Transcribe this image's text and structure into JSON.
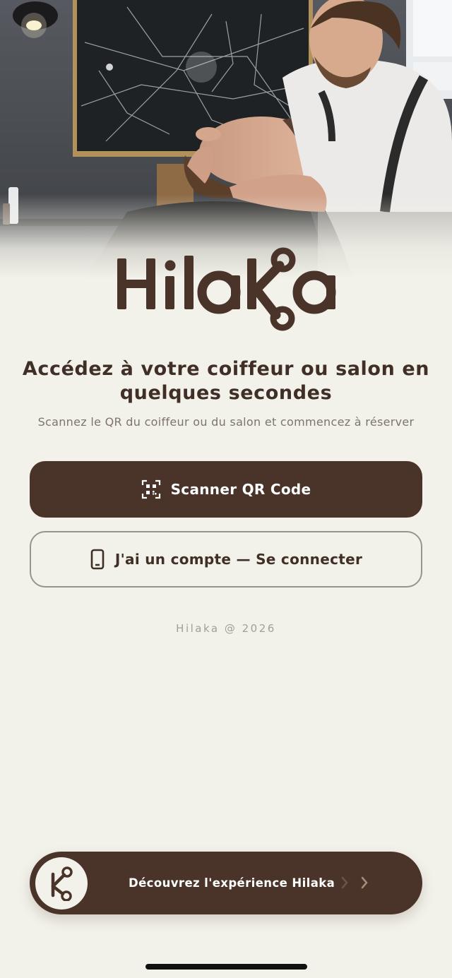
{
  "brand": {
    "name": "Hilaka",
    "primary_color": "#4a342a",
    "background_color": "#f3f2ea"
  },
  "hero": {
    "image": "barber-shaving-client-photo"
  },
  "headline": "Accédez à votre coiffeur ou salon en quelques secondes",
  "subheadline": "Scannez le QR du coiffeur ou du salon et commencez à réserver",
  "actions": {
    "scan": {
      "label": "Scanner QR Code",
      "icon": "qr-code-icon"
    },
    "login": {
      "label": "J'ai un compte — Se connecter",
      "icon": "phone-icon"
    }
  },
  "footer": {
    "copyright": "Hilaka @ 2026"
  },
  "discover": {
    "label": "Découvrez l'expérience Hilaka",
    "icon": "hilaka-monogram-icon",
    "chevrons": [
      "chevron-right-icon",
      "chevron-right-icon"
    ]
  }
}
